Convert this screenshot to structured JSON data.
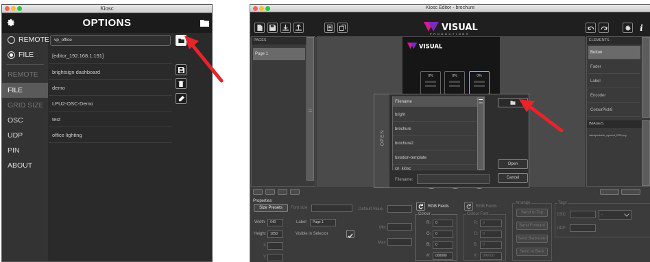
{
  "left_window": {
    "title": "Kiosc",
    "header_title": "OPTIONS",
    "radio_options": [
      {
        "label": "REMOTE",
        "selected": false
      },
      {
        "label": "FILE",
        "selected": true
      }
    ],
    "nav_items": [
      {
        "label": "REMOTE",
        "state": "dim"
      },
      {
        "label": "FILE",
        "state": "active"
      },
      {
        "label": "GRID SIZE",
        "state": "dim"
      },
      {
        "label": "OSC",
        "state": "normal"
      },
      {
        "label": "UDP",
        "state": "normal"
      },
      {
        "label": "PIN",
        "state": "normal"
      },
      {
        "label": "ABOUT",
        "state": "normal"
      }
    ],
    "search_value": "vp_office",
    "files": [
      "[editor_192.168.1.191]",
      "brightsign dashboard",
      "demo",
      "LPU2-OSC-Demo",
      "test",
      "office lighting"
    ]
  },
  "right_window": {
    "title": "Kiosc Editor - brochure",
    "brand": "VISUAL",
    "brand_sub": "PRODUCTIONS",
    "pages_header": "PAGES",
    "pages": [
      "Page 1"
    ],
    "elements_header": "ELEMENTS",
    "elements": [
      "Button",
      "Fader",
      "Label",
      "Encoder",
      "ColourPick8"
    ],
    "images_header": "IMAGES",
    "images": [
      "visualproductio_nground_RGB.png"
    ],
    "phone_buttons": [
      "0%",
      "0%",
      "0%"
    ],
    "open_dialog": {
      "tab_label": "OPEN",
      "list_header": "Filename",
      "files": [
        "bright",
        "brochure",
        "brochure2",
        "bstation-template",
        "cn_kiosc"
      ],
      "open_button": "Open",
      "cancel_button": "Cancel",
      "filename_label": "Filename:"
    },
    "properties": {
      "header": "Properties",
      "size_presets": "Size Presets",
      "font_size_label": "Font size",
      "width_label": "Width",
      "width_value": "640",
      "height_label": "Height",
      "height_value": "1050",
      "x_label": "X",
      "y_label": "Y",
      "label_label": "Label",
      "label_value": "Page 1",
      "visible_label": "Visible in Selector",
      "default_value_label": "Default Value",
      "min_label": "Min",
      "max_label": "Max",
      "rgb_fields_label": "RGB Fields",
      "colour_label": "Colour",
      "colour_font_label": "Colour Font",
      "r_label": "R:",
      "g_label": "G:",
      "b_label": "B:",
      "hex_label": "#:",
      "r_value": "0",
      "g_value": "0",
      "b_value": "0",
      "hex_value": "000000",
      "arrange_label": "Arrange",
      "arrange_buttons": [
        "Send to Top",
        "Send Forward",
        "Send Backward",
        "Send to Back"
      ],
      "tags_label": "Tags",
      "osc_label": "OSC",
      "udp_label": "UDP",
      "tag_select_value": "-"
    }
  },
  "colors": {
    "annotation_arrow": "#e8232a",
    "accent_frame": "#e0a21c"
  }
}
